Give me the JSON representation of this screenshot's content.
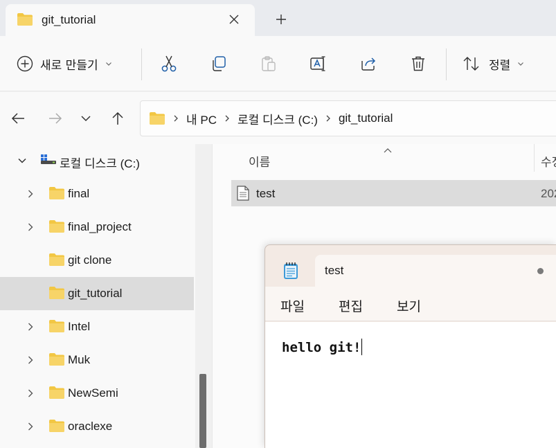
{
  "tabs": [
    {
      "label": "git_tutorial"
    }
  ],
  "toolbar": {
    "new_label": "새로 만들기",
    "sort_label": "정렬"
  },
  "breadcrumb": [
    "내 PC",
    "로컬 디스크 (C:)",
    "git_tutorial"
  ],
  "sidebar": {
    "root": {
      "label": "로컬 디스크 (C:)",
      "expanded": true
    },
    "items": [
      {
        "label": "final",
        "has_children": true,
        "selected": false
      },
      {
        "label": "final_project",
        "has_children": true,
        "selected": false
      },
      {
        "label": "git clone",
        "has_children": false,
        "selected": false
      },
      {
        "label": "git_tutorial",
        "has_children": false,
        "selected": true
      },
      {
        "label": "Intel",
        "has_children": true,
        "selected": false
      },
      {
        "label": "Muk",
        "has_children": true,
        "selected": false
      },
      {
        "label": "NewSemi",
        "has_children": true,
        "selected": false
      },
      {
        "label": "oraclexe",
        "has_children": true,
        "selected": false
      }
    ]
  },
  "content": {
    "columns": [
      "이름",
      "수정"
    ],
    "files": [
      {
        "name": "test",
        "date": "202"
      }
    ]
  },
  "notepad": {
    "tab_title": "test",
    "menus": [
      "파일",
      "편집",
      "보기"
    ],
    "text": "hello git!"
  },
  "colors": {
    "folder": "#f2c744",
    "selection": "#dcdcdc",
    "notepad_frame": "#f3eae4"
  }
}
